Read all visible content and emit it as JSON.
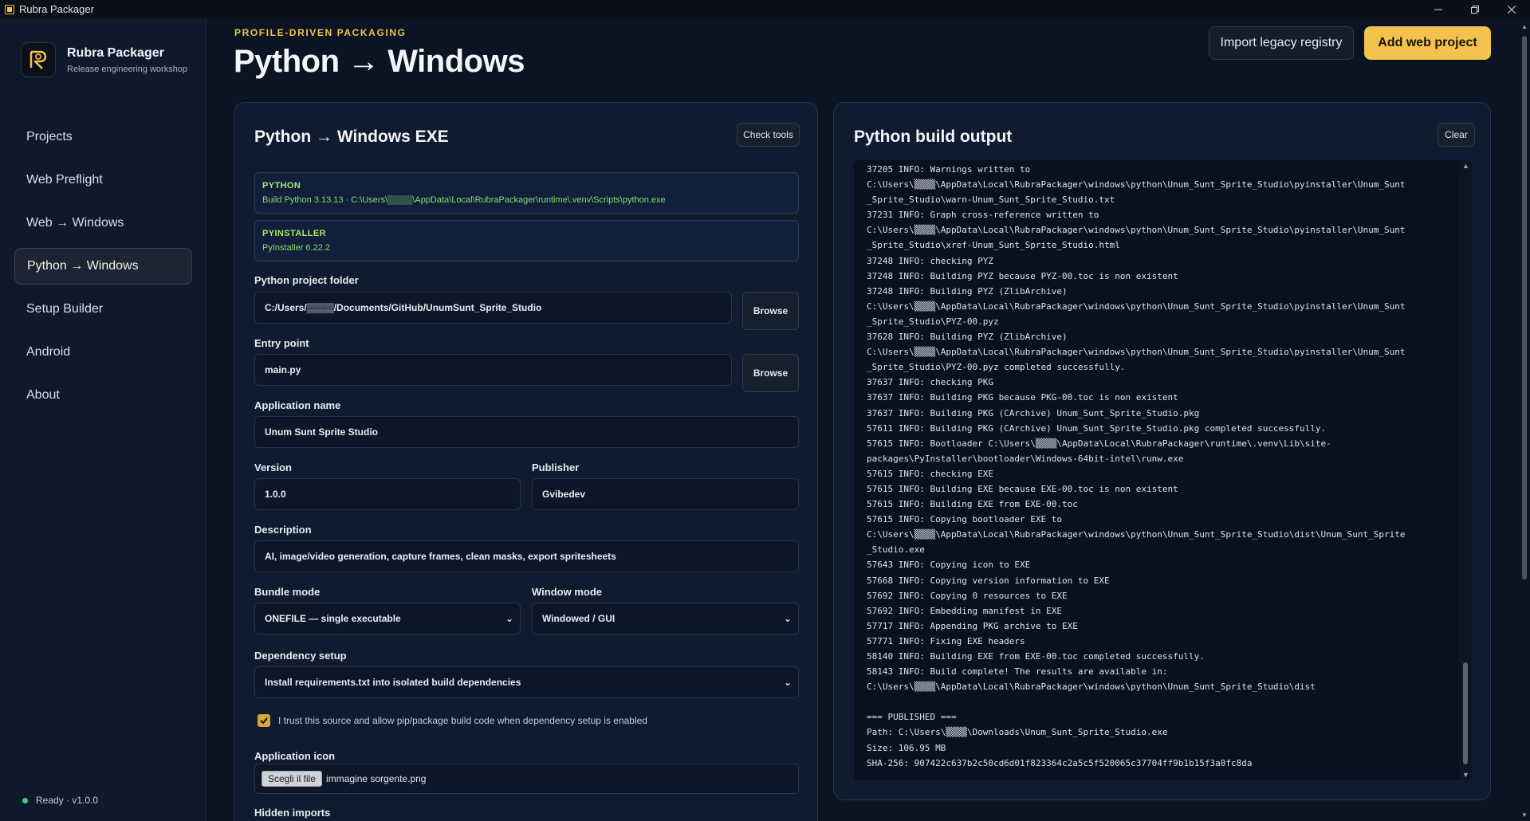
{
  "window": {
    "title": "Rubra Packager",
    "controls": [
      "minimize-icon",
      "restore-icon",
      "close-icon"
    ]
  },
  "sidebar": {
    "brand_name": "Rubra Packager",
    "brand_sub": "Release engineering workshop",
    "items": [
      {
        "label": "Projects"
      },
      {
        "label": "Web Preflight"
      },
      {
        "label": "Web → Windows"
      },
      {
        "label": "Python → Windows",
        "active": true
      },
      {
        "label": "Setup Builder"
      },
      {
        "label": "Android"
      },
      {
        "label": "About"
      }
    ],
    "status": "Ready · v1.0.0"
  },
  "header": {
    "eyebrow": "PROFILE-DRIVEN PACKAGING",
    "title": "Python → Windows",
    "import_button": "Import legacy registry",
    "add_button": "Add web project"
  },
  "form": {
    "title": "Python → Windows EXE",
    "check_tools": "Check tools",
    "python_label": "PYTHON",
    "python_value": "Build Python 3.13.13 · C:\\Users\\▒▒▒▒\\AppData\\Local\\RubraPackager\\runtime\\.venv\\Scripts\\python.exe",
    "pyinstaller_label": "PYINSTALLER",
    "pyinstaller_value": "PyInstaller 6.22.2",
    "project_folder_label": "Python project folder",
    "project_folder_value": "C:/Users/▒▒▒▒/Documents/GitHub/UnumSunt_Sprite_Studio",
    "browse": "Browse",
    "entry_label": "Entry point",
    "entry_value": "main.py",
    "app_name_label": "Application name",
    "app_name_value": "Unum Sunt Sprite Studio",
    "version_label": "Version",
    "version_value": "1.0.0",
    "publisher_label": "Publisher",
    "publisher_value": "Gvibedev",
    "description_label": "Description",
    "description_value": "AI, image/video generation, capture frames, clean masks, export spritesheets",
    "bundle_label": "Bundle mode",
    "bundle_value": "ONEFILE — single executable",
    "window_label": "Window mode",
    "window_value": "Windowed / GUI",
    "dependency_label": "Dependency setup",
    "dependency_value": "Install requirements.txt into isolated build dependencies",
    "trust_text": "I trust this source and allow pip/package build code when dependency setup is enabled",
    "trust_checked": true,
    "icon_label": "Application icon",
    "choose_file": "Scegli il file",
    "icon_file": "immagine sorgente.png",
    "hidden_imports_label": "Hidden imports"
  },
  "output": {
    "title": "Python build output",
    "clear": "Clear",
    "log": "37205 INFO: Warnings written to\nC:\\Users\\▒▒▒▒\\AppData\\Local\\RubraPackager\\windows\\python\\Unum_Sunt_Sprite_Studio\\pyinstaller\\Unum_Sunt\n_Sprite_Studio\\warn-Unum_Sunt_Sprite_Studio.txt\n37231 INFO: Graph cross-reference written to\nC:\\Users\\▒▒▒▒\\AppData\\Local\\RubraPackager\\windows\\python\\Unum_Sunt_Sprite_Studio\\pyinstaller\\Unum_Sunt\n_Sprite_Studio\\xref-Unum_Sunt_Sprite_Studio.html\n37248 INFO: checking PYZ\n37248 INFO: Building PYZ because PYZ-00.toc is non existent\n37248 INFO: Building PYZ (ZlibArchive)\nC:\\Users\\▒▒▒▒\\AppData\\Local\\RubraPackager\\windows\\python\\Unum_Sunt_Sprite_Studio\\pyinstaller\\Unum_Sunt\n_Sprite_Studio\\PYZ-00.pyz\n37628 INFO: Building PYZ (ZlibArchive)\nC:\\Users\\▒▒▒▒\\AppData\\Local\\RubraPackager\\windows\\python\\Unum_Sunt_Sprite_Studio\\pyinstaller\\Unum_Sunt\n_Sprite_Studio\\PYZ-00.pyz completed successfully.\n37637 INFO: checking PKG\n37637 INFO: Building PKG because PKG-00.toc is non existent\n37637 INFO: Building PKG (CArchive) Unum_Sunt_Sprite_Studio.pkg\n57611 INFO: Building PKG (CArchive) Unum_Sunt_Sprite_Studio.pkg completed successfully.\n57615 INFO: Bootloader C:\\Users\\▒▒▒▒\\AppData\\Local\\RubraPackager\\runtime\\.venv\\Lib\\site-\npackages\\PyInstaller\\bootloader\\Windows-64bit-intel\\runw.exe\n57615 INFO: checking EXE\n57615 INFO: Building EXE because EXE-00.toc is non existent\n57615 INFO: Building EXE from EXE-00.toc\n57615 INFO: Copying bootloader EXE to\nC:\\Users\\▒▒▒▒\\AppData\\Local\\RubraPackager\\windows\\python\\Unum_Sunt_Sprite_Studio\\dist\\Unum_Sunt_Sprite\n_Studio.exe\n57643 INFO: Copying icon to EXE\n57668 INFO: Copying version information to EXE\n57692 INFO: Copying 0 resources to EXE\n57692 INFO: Embedding manifest in EXE\n57717 INFO: Appending PKG archive to EXE\n57771 INFO: Fixing EXE headers\n58140 INFO: Building EXE from EXE-00.toc completed successfully.\n58143 INFO: Build complete! The results are available in:\nC:\\Users\\▒▒▒▒\\AppData\\Local\\RubraPackager\\windows\\python\\Unum_Sunt_Sprite_Studio\\dist\n\n=== PUBLISHED ===\nPath: C:\\Users\\▒▒▒▒\\Downloads\\Unum_Sunt_Sprite_Studio.exe\nSize: 106.95 MB\nSHA-256: 907422c637b2c50cd6d01f823364c2a5c5f520065c37704ff9b1b15f3a0fc8da"
  },
  "colors": {
    "accent": "#f2c14e",
    "background": "#0b1422",
    "panel": "#0f1c30",
    "ok_text": "#8fd66a",
    "status_dot": "#3ccf7e"
  }
}
